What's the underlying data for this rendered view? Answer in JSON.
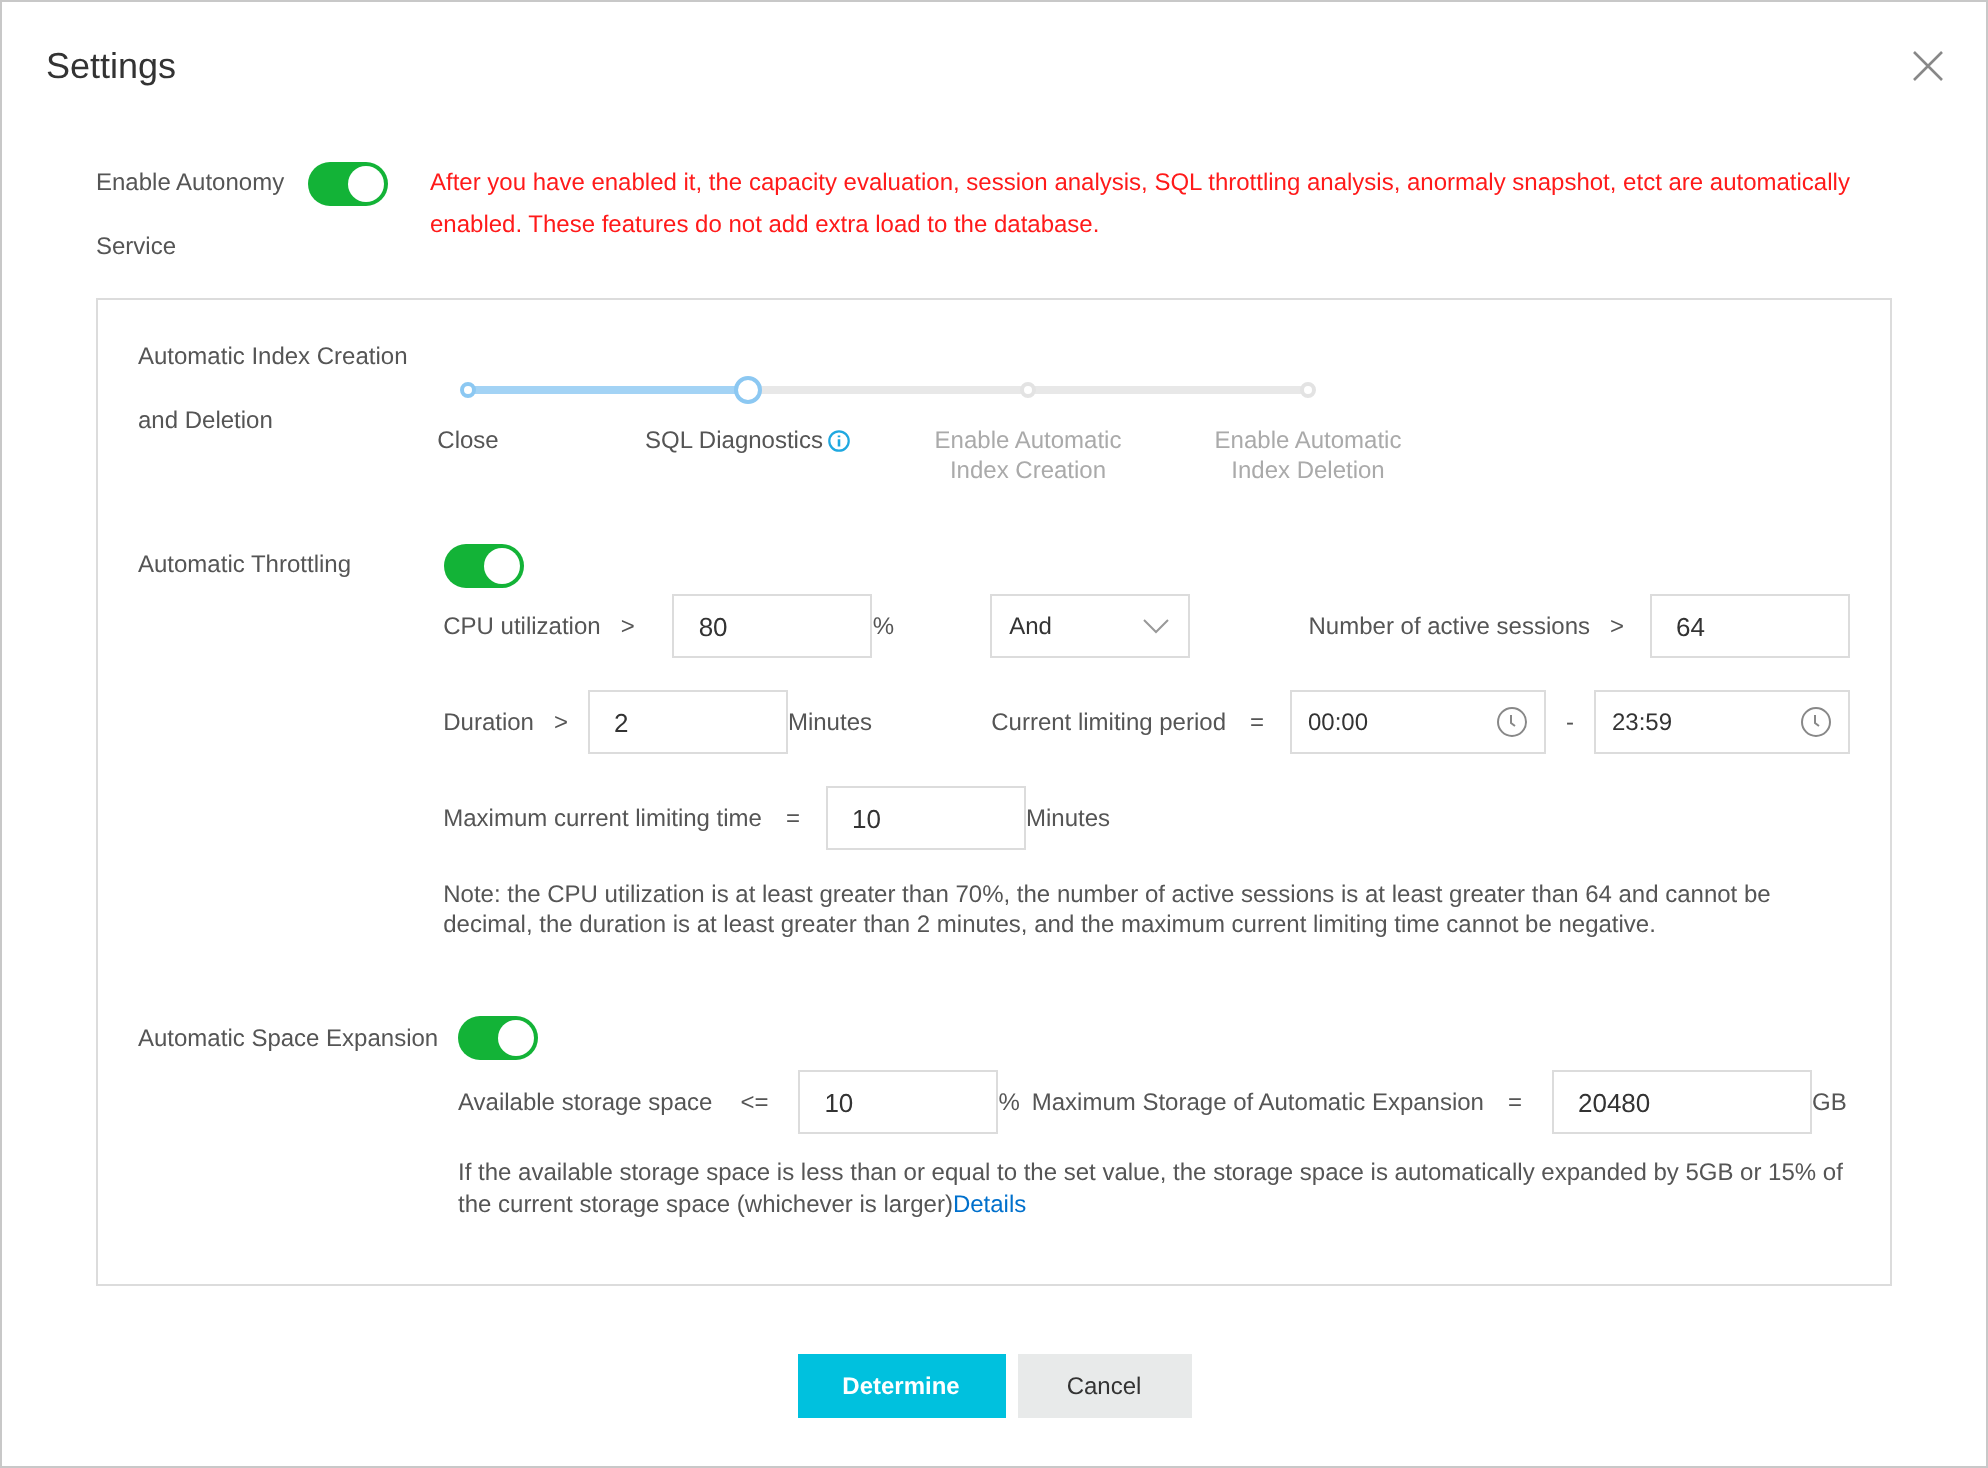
{
  "dialog": {
    "title": "Settings"
  },
  "autonomy": {
    "label": "Enable Autonomy Service",
    "on": true,
    "notice": "After you have enabled it, the capacity evaluation, session analysis, SQL throttling analysis, anormaly snapshot, etct are automatically enabled. These features do not add extra load to the database."
  },
  "index": {
    "label": "Automatic Index Creation and Deletion",
    "steps": [
      {
        "label": "Close",
        "selected": false,
        "has_info": false
      },
      {
        "label": "SQL Diagnostics",
        "selected": true,
        "has_info": true
      },
      {
        "label": "Enable Automatic Index Creation",
        "selected": false,
        "has_info": false
      },
      {
        "label": "Enable Automatic Index Deletion",
        "selected": false,
        "has_info": false
      }
    ]
  },
  "throttling": {
    "label": "Automatic Throttling",
    "on": true,
    "cpu": {
      "label": "CPU utilization",
      "op": ">",
      "value": "80",
      "unit": "%"
    },
    "logic": "And",
    "sessions": {
      "label": "Number of active sessions",
      "op": ">",
      "value": "64"
    },
    "duration": {
      "label": "Duration",
      "op": ">",
      "value": "2",
      "unit": "Minutes"
    },
    "period": {
      "label": "Current limiting period",
      "op": "=",
      "start": "00:00",
      "separator": "-",
      "end": "23:59"
    },
    "max_time": {
      "label": "Maximum current limiting time",
      "op": "=",
      "value": "10",
      "unit": "Minutes"
    },
    "note": "Note: the CPU utilization is at least greater than 70%, the number of active sessions is at least greater than 64 and cannot be decimal, the duration is at least greater than 2 minutes, and the maximum current limiting time cannot be negative."
  },
  "expansion": {
    "label": "Automatic Space Expansion",
    "on": true,
    "available": {
      "label": "Available storage space",
      "op": "<=",
      "value": "10",
      "unit": "%"
    },
    "max_storage": {
      "label": "Maximum Storage of Automatic Expansion",
      "op": "=",
      "value": "20480",
      "unit": "GB"
    },
    "note": "If the available storage space is less than or equal to the set value, the storage space is automatically expanded by 5GB or 15% of the current storage space (whichever is larger)",
    "link": "Details"
  },
  "buttons": [
    {
      "label": "Determine",
      "kind": "primary"
    },
    {
      "label": "Cancel",
      "kind": "default"
    }
  ]
}
